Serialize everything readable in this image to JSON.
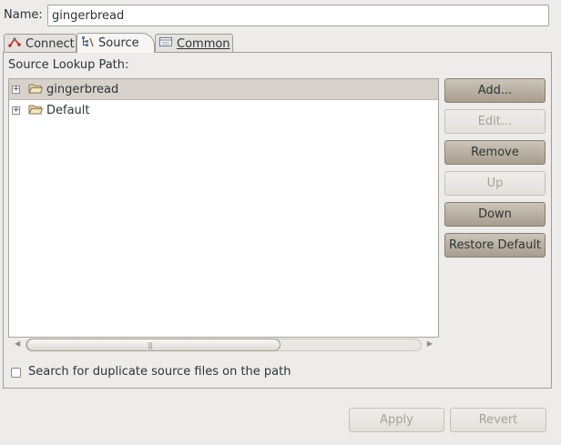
{
  "name": {
    "label": "Name:",
    "value": "gingerbread"
  },
  "tabs": [
    {
      "label": "Connect",
      "icon": "connect-icon",
      "active": false
    },
    {
      "label": "Source",
      "icon": "source-icon",
      "active": true
    },
    {
      "label": "Common",
      "icon": "common-icon",
      "active": false
    }
  ],
  "source": {
    "lookup_label": "Source Lookup Path:",
    "entries": [
      {
        "label": "gingerbread",
        "icon": "folder-icon",
        "selected": true
      },
      {
        "label": "Default",
        "icon": "folder-icon",
        "selected": false
      }
    ],
    "buttons": {
      "add": "Add...",
      "edit": "Edit...",
      "remove": "Remove",
      "up": "Up",
      "down": "Down",
      "restore": "Restore Default"
    },
    "duplicate_search_label": "Search for duplicate source files on the path",
    "duplicate_search_checked": false
  },
  "footer": {
    "apply": "Apply",
    "revert": "Revert"
  },
  "colors": {
    "selection": "#d6d2cb",
    "button": "#b9b1a3"
  }
}
